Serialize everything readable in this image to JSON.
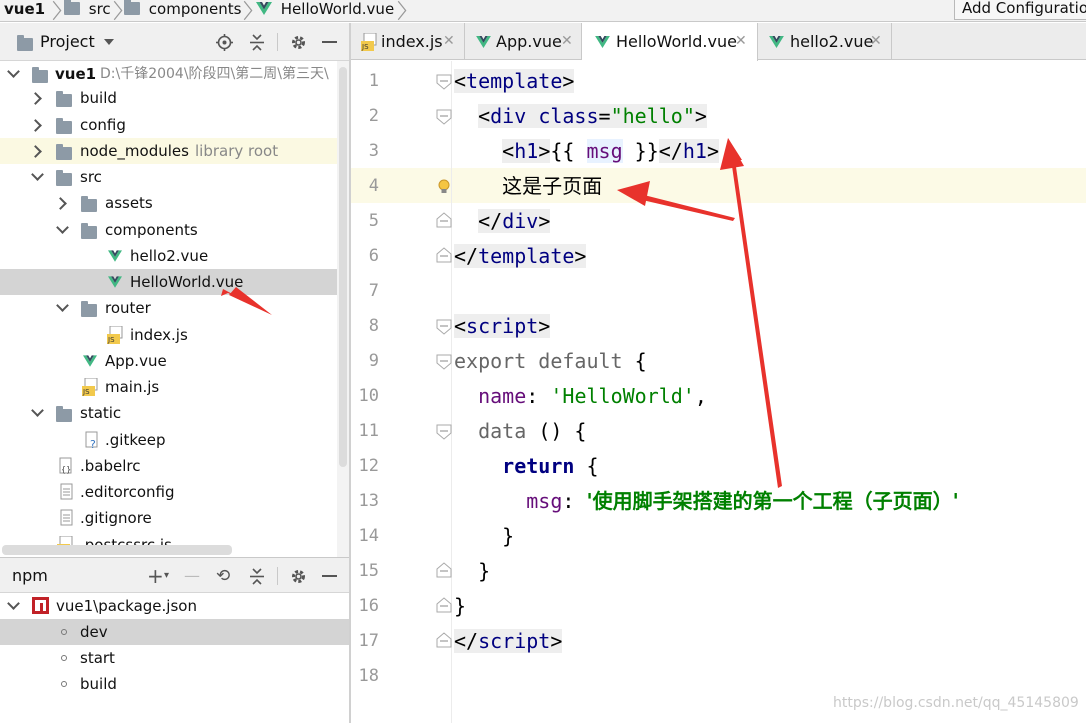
{
  "breadcrumb": {
    "items": [
      "vue1",
      "src",
      "components",
      "HelloWorld.vue"
    ],
    "add_config": "Add Configuratio"
  },
  "project_panel": {
    "title": "Project",
    "root_name": "vue1",
    "root_path": "D:\\千锋2004\\阶段四\\第二周\\第三天\\",
    "tree": [
      {
        "label": "build",
        "indent": 1,
        "kind": "folder",
        "state": "collapsed"
      },
      {
        "label": "config",
        "indent": 1,
        "kind": "folder",
        "state": "collapsed"
      },
      {
        "label": "node_modules",
        "indent": 1,
        "kind": "folder",
        "state": "collapsed",
        "suffix": "library root"
      },
      {
        "label": "src",
        "indent": 1,
        "kind": "folder",
        "state": "expanded"
      },
      {
        "label": "assets",
        "indent": 2,
        "kind": "folder",
        "state": "collapsed"
      },
      {
        "label": "components",
        "indent": 2,
        "kind": "folder",
        "state": "expanded"
      },
      {
        "label": "hello2.vue",
        "indent": 3,
        "kind": "vue"
      },
      {
        "label": "HelloWorld.vue",
        "indent": 3,
        "kind": "vue",
        "selected": true
      },
      {
        "label": "router",
        "indent": 2,
        "kind": "folder",
        "state": "expanded"
      },
      {
        "label": "index.js",
        "indent": 3,
        "kind": "js"
      },
      {
        "label": "App.vue",
        "indent": 2,
        "kind": "vue"
      },
      {
        "label": "main.js",
        "indent": 2,
        "kind": "js"
      },
      {
        "label": "static",
        "indent": 1,
        "kind": "folder",
        "state": "expanded"
      },
      {
        "label": ".gitkeep",
        "indent": 2,
        "kind": "unknown"
      },
      {
        "label": ".babelrc",
        "indent": 1,
        "kind": "config"
      },
      {
        "label": ".editorconfig",
        "indent": 1,
        "kind": "file"
      },
      {
        "label": ".gitignore",
        "indent": 1,
        "kind": "file"
      },
      {
        "label": ".postcssrc.js",
        "indent": 1,
        "kind": "js"
      }
    ]
  },
  "npm_panel": {
    "title": "npm",
    "package": "vue1\\package.json",
    "scripts": [
      {
        "label": "dev",
        "selected": true
      },
      {
        "label": "start"
      },
      {
        "label": "build"
      }
    ]
  },
  "tabs": [
    {
      "label": "index.js",
      "kind": "js"
    },
    {
      "label": "App.vue",
      "kind": "vue"
    },
    {
      "label": "HelloWorld.vue",
      "kind": "vue",
      "active": true
    },
    {
      "label": "hello2.vue",
      "kind": "vue"
    }
  ],
  "editor": {
    "line_numbers": [
      "1",
      "2",
      "3",
      "4",
      "5",
      "6",
      "7",
      "8",
      "9",
      "10",
      "11",
      "12",
      "13",
      "14",
      "15",
      "16",
      "17",
      "18"
    ],
    "code": {
      "template_open": "template",
      "div": "div",
      "class_attr": "class",
      "class_value": "\"hello\"",
      "h1": "h1",
      "mustache_open": "{{",
      "msg_ref": "msg",
      "mustache_close": "}}",
      "child_text": "这是子页面",
      "script_tag": "script",
      "export": "export",
      "default_kw": "default",
      "name_key": "name",
      "name_value": "'HelloWorld'",
      "data_fn": "data",
      "return_kw": "return",
      "msg_key": "msg",
      "msg_value": "'使用脚手架搭建的第一个工程（子页面）'"
    }
  },
  "watermark": "https://blog.csdn.net/qq_45145809",
  "colors": {
    "accent_annotation": "#e8322c",
    "vue_green": "#41b883",
    "vue_dark": "#34495e",
    "string": "#008000",
    "keyword": "#000080"
  }
}
